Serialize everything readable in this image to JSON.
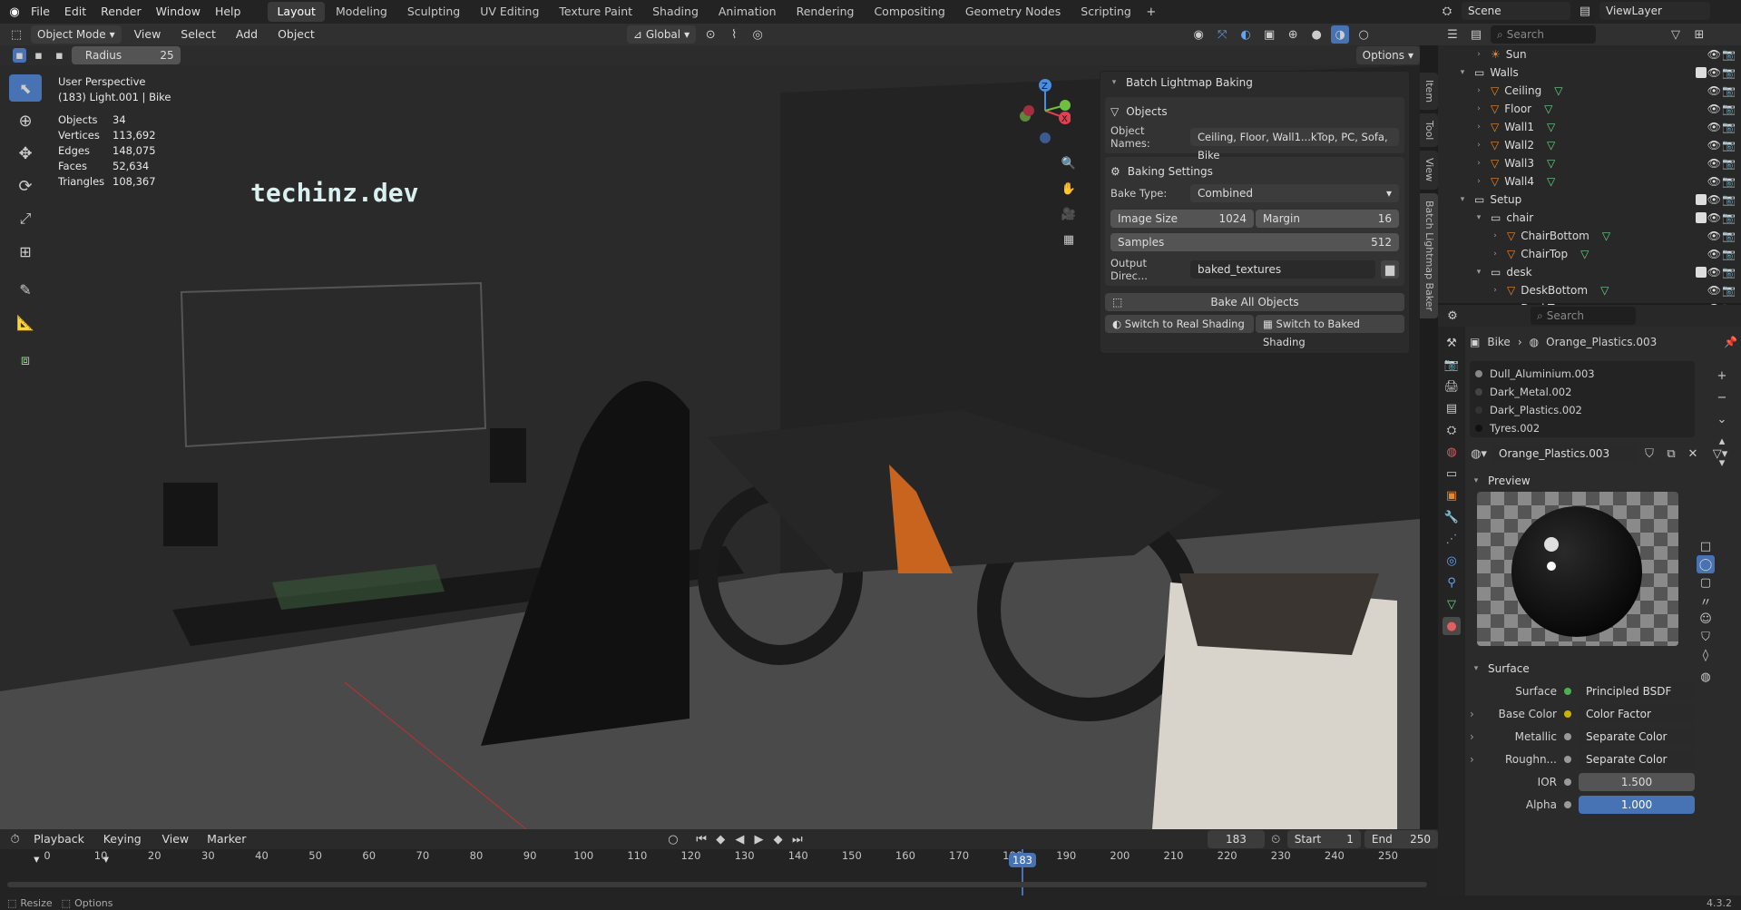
{
  "topbar": {
    "menus": [
      "File",
      "Edit",
      "Render",
      "Window",
      "Help"
    ],
    "workspaces": [
      "Layout",
      "Modeling",
      "Sculpting",
      "UV Editing",
      "Texture Paint",
      "Shading",
      "Animation",
      "Rendering",
      "Compositing",
      "Geometry Nodes",
      "Scripting"
    ],
    "active_workspace": "Layout",
    "scene_label": "Scene",
    "viewlayer_label": "ViewLayer"
  },
  "viewport_header": {
    "mode": "Object Mode",
    "menus": [
      "View",
      "Select",
      "Add",
      "Object"
    ],
    "orientation": "Global",
    "options_label": "Options",
    "radius_label": "Radius",
    "radius_value": "25"
  },
  "viewport_info": {
    "perspective": "User Perspective",
    "context": "(183) Light.001 | Bike",
    "stats": [
      {
        "label": "Objects",
        "value": "34"
      },
      {
        "label": "Vertices",
        "value": "113,692"
      },
      {
        "label": "Edges",
        "value": "148,075"
      },
      {
        "label": "Faces",
        "value": "52,634"
      },
      {
        "label": "Triangles",
        "value": "108,367"
      }
    ],
    "watermark": "techinz.dev"
  },
  "lightmap_panel": {
    "title": "Batch Lightmap Baking",
    "objects_header": "Objects",
    "object_names_label": "Object Names:",
    "object_names_value": "Ceiling, Floor, Wall1...kTop, PC, Sofa, Bike",
    "baking_header": "Baking Settings",
    "bake_type_label": "Bake Type:",
    "bake_type_value": "Combined",
    "image_size_label": "Image Size",
    "image_size_value": "1024",
    "margin_label": "Margin",
    "margin_value": "16",
    "samples_label": "Samples",
    "samples_value": "512",
    "output_label": "Output Direc...",
    "output_value": "baked_textures",
    "bake_all_label": "Bake All Objects",
    "real_shading_label": "Switch to Real Shading",
    "baked_shading_label": "Switch to Baked Shading"
  },
  "sidebar_tabs": [
    "Item",
    "Tool",
    "View",
    "Batch Lightmap Baker"
  ],
  "outliner": {
    "search_placeholder": "Search",
    "rows": [
      {
        "label": "Sun",
        "indent": 1,
        "type": "light",
        "check": false
      },
      {
        "label": "Walls",
        "indent": 0,
        "type": "collection",
        "check": true
      },
      {
        "label": "Ceiling",
        "indent": 1,
        "type": "mesh",
        "check": false
      },
      {
        "label": "Floor",
        "indent": 1,
        "type": "mesh",
        "check": false
      },
      {
        "label": "Wall1",
        "indent": 1,
        "type": "mesh",
        "check": false
      },
      {
        "label": "Wall2",
        "indent": 1,
        "type": "mesh",
        "check": false
      },
      {
        "label": "Wall3",
        "indent": 1,
        "type": "mesh",
        "check": false
      },
      {
        "label": "Wall4",
        "indent": 1,
        "type": "mesh",
        "check": false
      },
      {
        "label": "Setup",
        "indent": 0,
        "type": "collection",
        "check": true
      },
      {
        "label": "chair",
        "indent": 1,
        "type": "collection",
        "check": true
      },
      {
        "label": "ChairBottom",
        "indent": 2,
        "type": "mesh",
        "check": false
      },
      {
        "label": "ChairTop",
        "indent": 2,
        "type": "mesh",
        "check": false
      },
      {
        "label": "desk",
        "indent": 1,
        "type": "collection",
        "check": true
      },
      {
        "label": "DeskBottom",
        "indent": 2,
        "type": "mesh",
        "check": false
      },
      {
        "label": "DeskTop",
        "indent": 2,
        "type": "mesh",
        "check": false
      }
    ]
  },
  "properties": {
    "search_placeholder": "Search",
    "breadcrumb_object": "Bike",
    "breadcrumb_material": "Orange_Plastics.003",
    "material_slots": [
      "Dull_Aluminium.003",
      "Dark_Metal.002",
      "Dark_Plastics.002",
      "Tyres.002"
    ],
    "active_material": "Orange_Plastics.003",
    "preview_header": "Preview",
    "surface_header": "Surface",
    "surface_rows": [
      {
        "label": "Surface",
        "value": "Principled BSDF",
        "dot": "#4caf50",
        "expand": false
      },
      {
        "label": "Base Color",
        "value": "Color Factor",
        "dot": "#c8b400",
        "expand": true
      },
      {
        "label": "Metallic",
        "value": "Separate Color",
        "dot": "#9a9a9a",
        "expand": true
      },
      {
        "label": "Roughn...",
        "value": "Separate Color",
        "dot": "#9a9a9a",
        "expand": true
      }
    ],
    "ior_label": "IOR",
    "ior_value": "1.500",
    "alpha_label": "Alpha",
    "alpha_value": "1.000"
  },
  "timeline": {
    "menus": [
      "Playback",
      "Keying",
      "View",
      "Marker"
    ],
    "current_frame": "183",
    "start_label": "Start",
    "start_value": "1",
    "end_label": "End",
    "end_value": "250",
    "ticks": [
      "0",
      "10",
      "20",
      "30",
      "40",
      "50",
      "60",
      "70",
      "80",
      "90",
      "100",
      "110",
      "120",
      "130",
      "140",
      "150",
      "160",
      "170",
      "180",
      "190",
      "200",
      "210",
      "220",
      "230",
      "240",
      "250"
    ]
  },
  "statusbar": {
    "left1": "Resize",
    "left2": "Options",
    "version": "4.3.2"
  },
  "colors": {
    "accent": "#4772b3",
    "orange": "#e8862a",
    "mesh_green": "#6fcf8b"
  }
}
